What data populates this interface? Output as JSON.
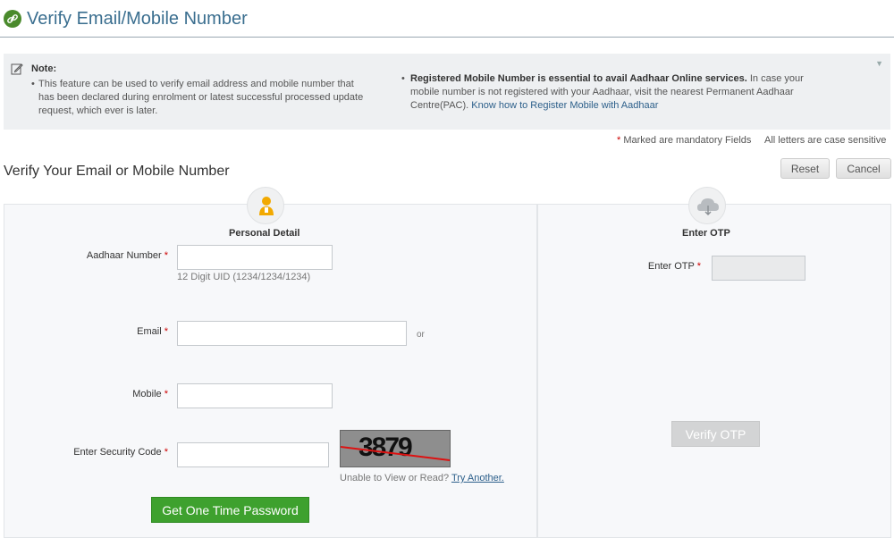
{
  "header": {
    "title": "Verify Email/Mobile Number"
  },
  "note": {
    "title": "Note:",
    "left_item": "This feature can be used to verify email address and mobile number that has been declared during enrolment or latest successful processed update request, which ever is later.",
    "right_item_bold": "Registered Mobile Number is essential to avail Aadhaar Online services.",
    "right_item_text": " In case your mobile number is not registered with your Aadhaar, visit the nearest Permanent Aadhaar Centre(PAC). ",
    "right_item_link": "Know how to Register Mobile with Aadhaar"
  },
  "info": {
    "mandatory_star": "*",
    "mandatory_text": " Marked are mandatory Fields",
    "case_sensitive": "All letters are case sensitive"
  },
  "section": {
    "title": "Verify Your Email or Mobile Number",
    "reset_label": "Reset",
    "cancel_label": "Cancel"
  },
  "personal": {
    "title": "Personal Detail",
    "aadhaar_label": "Aadhaar Number",
    "aadhaar_value": "",
    "aadhaar_hint": "12 Digit UID (1234/1234/1234)",
    "email_label": "Email",
    "email_value": "",
    "or_text": "or",
    "mobile_label": "Mobile",
    "mobile_value": "",
    "security_label": "Enter Security Code",
    "security_value": "",
    "captcha_text": "3879",
    "captcha_hint": "Unable to View or Read? ",
    "try_another": "Try Another.",
    "get_otp_label": "Get One Time Password",
    "star": "*"
  },
  "otp": {
    "title": "Enter OTP",
    "label": "Enter OTP",
    "value": "",
    "verify_label": "Verify OTP",
    "star": "*"
  },
  "icons": {
    "logo": "link-icon",
    "note": "pencil-icon",
    "personal": "person-icon",
    "otp": "cloud-icon",
    "collapse": "triangle-down-icon"
  },
  "colors": {
    "title": "#3a6e8f",
    "green_button": "#3ea12e",
    "disabled_button": "#d3d4d5",
    "required_star": "#cc0000",
    "link": "#2c5f8a"
  }
}
